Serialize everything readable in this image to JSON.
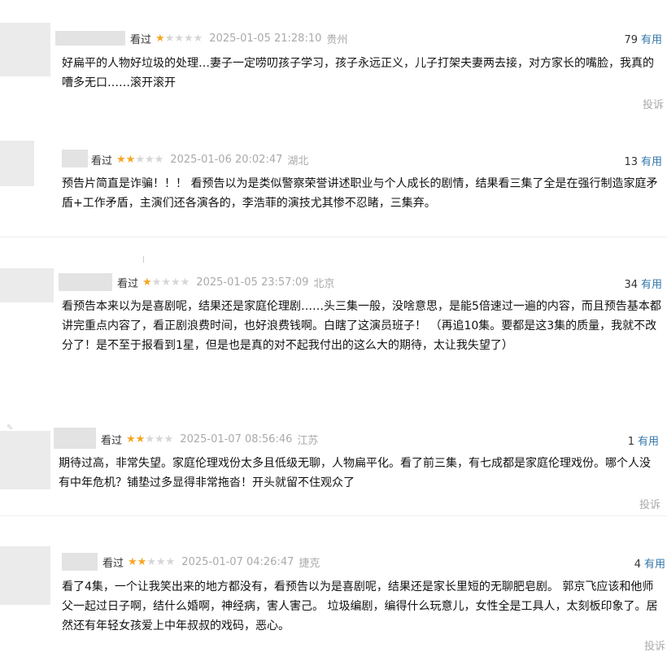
{
  "reviews": [
    {
      "status": "看过",
      "stars": 1,
      "time": "2025-01-05 21:28:10",
      "location": "贵州",
      "votes": "79",
      "vote_label": "有用",
      "content": "好扁平的人物好垃圾的处理…妻子一定唠叨孩子学习，孩子永远正义，儿子打架夫妻两去接，对方家长的嘴脸，我真的嘈多无口……滚开滚开",
      "report": "投诉"
    },
    {
      "status": "看过",
      "stars": 2,
      "time": "2025-01-06 20:02:47",
      "location": "湖北",
      "votes": "13",
      "vote_label": "有用",
      "content": "预告片简直是诈骗！！！ 看预告以为是类似警察荣誉讲述职业与个人成长的剧情，结果看三集了全是在强行制造家庭矛盾+工作矛盾，主演们还各演各的，李浩菲的演技尤其惨不忍睹，三集弃。",
      "report": ""
    },
    {
      "status": "看过",
      "stars": 1,
      "time": "2025-01-05 23:57:09",
      "location": "北京",
      "votes": "34",
      "vote_label": "有用",
      "content": "看预告本来以为是喜剧呢，结果还是家庭伦理剧……头三集一般，没啥意思，是能5倍速过一遍的内容，而且预告基本都讲完重点内容了，看正剧浪费时间，也好浪费钱啊。白瞎了这演员班子！ （再追10集。要都是这3集的质量，我就不改分了！是不至于报看到1星，但是也是真的对不起我付出的这么大的期待，太让我失望了）",
      "report": ""
    },
    {
      "status": "看过",
      "stars": 2,
      "time": "2025-01-07 08:56:46",
      "location": "江苏",
      "votes": "1",
      "vote_label": "有用",
      "content": "期待过高，非常失望。家庭伦理戏份太多且低级无聊，人物扁平化。看了前三集，有七成都是家庭伦理戏份。哪个人没有中年危机？铺垫过多显得非常拖沓！开头就留不住观众了",
      "report": "投诉"
    },
    {
      "status": "看过",
      "stars": 2,
      "time": "2025-01-07 04:26:47",
      "location": "捷克",
      "votes": "4",
      "vote_label": "有用",
      "content": "看了4集，一个让我笑出来的地方都没有，看预告以为是喜剧呢，结果还是家长里短的无聊肥皂剧。 郭京飞应该和他师父一起过日子啊，结什么婚啊，神经病，害人害己。 垃圾编剧，编得什么玩意儿，女性全是工具人，太刻板印象了。居然还有年轻女孩爱上中年叔叔的戏码，恶心。",
      "report": "投诉"
    }
  ]
}
